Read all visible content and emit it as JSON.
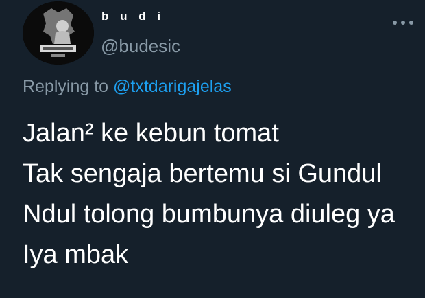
{
  "tweet": {
    "author": {
      "display_name": "b u d i",
      "handle": "@budesic",
      "avatar_icon": "profile-photo"
    },
    "more_icon": "more-dots-icon",
    "replying_prefix": "Replying to",
    "replying_to": "@txtdarigajelas",
    "lines": [
      "Jalan² ke kebun tomat",
      "Tak sengaja bertemu si Gundul",
      "Ndul tolong bumbunya diuleg ya",
      "Iya mbak"
    ]
  },
  "colors": {
    "background": "#15202b",
    "text": "#ffffff",
    "secondary": "#8899a6",
    "link": "#1da1f2"
  }
}
